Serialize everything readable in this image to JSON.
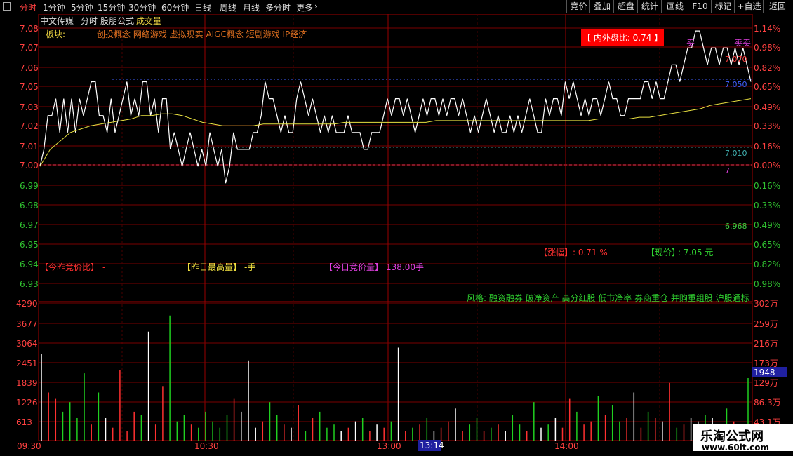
{
  "toolbar": {
    "menu_icon": "grid-icon",
    "tabs": [
      {
        "label": "分时",
        "active": true
      },
      {
        "label": "1分钟"
      },
      {
        "label": "5分钟"
      },
      {
        "label": "15分钟"
      },
      {
        "label": "30分钟"
      },
      {
        "label": "60分钟"
      },
      {
        "label": "日线"
      },
      {
        "label": "周线"
      },
      {
        "label": "月线"
      },
      {
        "label": "多分时"
      },
      {
        "label": "更多"
      }
    ],
    "more_icon": "chevron-right-icon",
    "buttons": [
      "竞价",
      "叠加",
      "超盘",
      "统计",
      "画线",
      "F10",
      "标记",
      "+自选",
      "返回"
    ]
  },
  "header": {
    "stock_name": "中文传媒",
    "chart_mode": "分时",
    "formula": "股朋公式",
    "indicator": "成交量",
    "sectors_label": "板块:",
    "sectors": "创投概念 网络游戏 虚拟现实 AIGC概念 短剧游戏 IP经济"
  },
  "overlays": {
    "inout_ratio": "【 内外盘比: 0.74 】",
    "change_label": "【涨幅】",
    "change_value": ": 0.71 %",
    "price_label": "【现价】",
    "price_value": ": 7.05 元",
    "prev_auction_label": "【今昨竞价比】",
    "prev_auction_value": "-",
    "yest_high_label": "【昨日最高量】",
    "yest_high_value": "-手",
    "today_auction_label": "【今日竞价量】",
    "today_auction_value": "138.00手",
    "style_text": "风格:  融资融券 破净资产 高分红股 低市净率 券商重仓 并购重组股 沪股通标",
    "sell_mark_1": "卖",
    "sell_mark_2": "卖卖",
    "lvl_top": "7.070",
    "lvl_050": "7.050",
    "lvl_010": "7.010",
    "lvl_7": "7",
    "lvl_6968": "6.968",
    "vol_current": "1948"
  },
  "axes": {
    "price_left": [
      "7.08",
      "7.07",
      "7.06",
      "7.05",
      "7.03",
      "7.02",
      "7.01",
      "7.00",
      "6.99",
      "6.98",
      "6.97",
      "6.95",
      "6.94",
      "6.93"
    ],
    "pct_right": [
      "1.14%",
      "0.98%",
      "0.82%",
      "0.65%",
      "0.49%",
      "0.33%",
      "0.16%",
      "0.00%",
      "0.16%",
      "0.33%",
      "0.49%",
      "0.65%",
      "0.82%",
      "0.98%"
    ],
    "vol_left": [
      "4290",
      "3677",
      "3064",
      "2451",
      "1839",
      "1226",
      "613"
    ],
    "vol_right": [
      "302万",
      "259万",
      "216万",
      "173万",
      "129万",
      "86.3万",
      "43.1万"
    ],
    "time_labels": [
      "09:30",
      "10:30",
      "13:00",
      "14:00"
    ],
    "cursor_time": "13:14"
  },
  "watermark": {
    "title": "乐淘公式网",
    "url": "www.60lt.com"
  },
  "chart_data": {
    "type": "line",
    "title": "",
    "price_range": [
      6.92,
      7.09
    ],
    "prev_close": 7.0,
    "price": [
      7.0,
      7.01,
      7.03,
      7.03,
      7.04,
      7.02,
      7.04,
      7.02,
      7.04,
      7.02,
      7.04,
      7.03,
      7.04,
      7.05,
      7.05,
      7.03,
      7.03,
      7.02,
      7.04,
      7.02,
      7.03,
      7.04,
      7.05,
      7.03,
      7.04,
      7.03,
      7.05,
      7.05,
      7.03,
      7.04,
      7.02,
      7.04,
      7.04,
      7.01,
      7.02,
      7.01,
      7.0,
      7.01,
      7.02,
      7.01,
      7.0,
      7.01,
      7.0,
      7.02,
      7.01,
      7.0,
      7.01,
      6.99,
      7.0,
      7.02,
      7.01,
      7.01,
      7.01,
      7.01,
      7.02,
      7.02,
      7.03,
      7.05,
      7.04,
      7.04,
      7.03,
      7.02,
      7.03,
      7.02,
      7.02,
      7.04,
      7.05,
      7.04,
      7.03,
      7.04,
      7.03,
      7.02,
      7.03,
      7.02,
      7.03,
      7.02,
      7.02,
      7.02,
      7.03,
      7.02,
      7.02,
      7.02,
      7.01,
      7.01,
      7.02,
      7.02,
      7.02,
      7.03,
      7.04,
      7.03,
      7.04,
      7.04,
      7.03,
      7.04,
      7.03,
      7.02,
      7.03,
      7.04,
      7.03,
      7.04,
      7.04,
      7.03,
      7.04,
      7.03,
      7.04,
      7.04,
      7.03,
      7.04,
      7.03,
      7.02,
      7.03,
      7.02,
      7.03,
      7.04,
      7.03,
      7.02,
      7.03,
      7.02,
      7.02,
      7.03,
      7.02,
      7.03,
      7.02,
      7.03,
      7.04,
      7.03,
      7.02,
      7.02,
      7.04,
      7.03,
      7.04,
      7.04,
      7.03,
      7.05,
      7.04,
      7.05,
      7.04,
      7.03,
      7.04,
      7.03,
      7.04,
      7.04,
      7.03,
      7.04,
      7.05,
      7.04,
      7.04,
      7.03,
      7.03,
      7.04,
      7.04,
      7.04,
      7.04,
      7.05,
      7.05,
      7.04,
      7.05,
      7.04,
      7.04,
      7.05,
      7.06,
      7.06,
      7.05,
      7.06,
      7.07,
      7.07,
      7.08,
      7.08,
      7.07,
      7.06,
      7.07,
      7.07,
      7.06,
      7.07,
      7.07,
      7.06,
      7.07,
      7.06,
      7.07,
      7.06,
      7.05
    ],
    "avg_price": [
      7.0,
      7.01,
      7.015,
      7.02,
      7.022,
      7.024,
      7.025,
      7.026,
      7.027,
      7.028,
      7.03,
      7.03,
      7.031,
      7.031,
      7.03,
      7.028,
      7.026,
      7.025,
      7.024,
      7.024,
      7.024,
      7.024,
      7.025,
      7.025,
      7.025,
      7.025,
      7.025,
      7.025,
      7.025,
      7.025,
      7.026,
      7.026,
      7.026,
      7.026,
      7.026,
      7.026,
      7.026,
      7.026,
      7.026,
      7.027,
      7.027,
      7.027,
      7.027,
      7.027,
      7.027,
      7.027,
      7.027,
      7.027,
      7.027,
      7.027,
      7.027,
      7.027,
      7.027,
      7.027,
      7.027,
      7.028,
      7.028,
      7.028,
      7.028,
      7.029,
      7.029,
      7.03,
      7.031,
      7.032,
      7.033,
      7.034,
      7.036,
      7.037,
      7.038,
      7.039,
      7.04
    ],
    "volume": [
      2700,
      1500,
      1300,
      900,
      1200,
      700,
      2100,
      500,
      1500,
      700,
      400,
      2200,
      300,
      900,
      800,
      3400,
      500,
      1700,
      3900,
      600,
      800,
      500,
      400,
      900,
      600,
      400,
      800,
      1300,
      900,
      2500,
      400,
      600,
      1200,
      800,
      500,
      400,
      1100,
      300,
      700,
      900,
      400,
      500,
      300,
      400,
      600,
      700,
      300,
      500,
      400,
      600,
      2900,
      300,
      400,
      500,
      700,
      300,
      400,
      600,
      1000,
      300,
      500,
      700,
      300,
      400,
      500,
      300,
      800,
      500,
      300,
      1200,
      400,
      500,
      700,
      400,
      1300,
      900,
      500,
      600,
      1400,
      800,
      1100,
      600,
      700,
      1500,
      400,
      900,
      700,
      600,
      1800,
      400,
      500,
      700,
      600,
      800,
      700,
      500,
      1000,
      600,
      300,
      1948
    ]
  }
}
